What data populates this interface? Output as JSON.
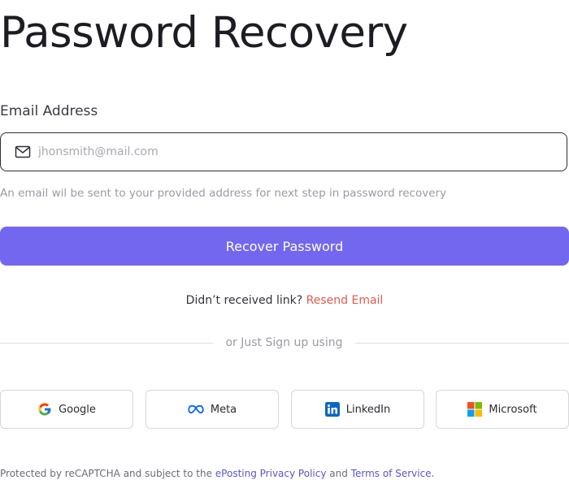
{
  "page": {
    "title": "Password Recovery"
  },
  "form": {
    "email_label": "Email Address",
    "email_placeholder": "jhonsmith@mail.com",
    "email_value": "",
    "hint": "An email wil be sent to your provided address for next step in password recovery",
    "submit_label": "Recover Password"
  },
  "resend": {
    "question": "Didn’t received link?",
    "link_label": "Resend Email"
  },
  "divider": {
    "text": "or Just Sign up using"
  },
  "social": [
    {
      "label": "Google",
      "icon": "google-icon"
    },
    {
      "label": "Meta",
      "icon": "meta-icon"
    },
    {
      "label": "LinkedIn",
      "icon": "linkedin-icon"
    },
    {
      "label": "Microsoft",
      "icon": "microsoft-icon"
    }
  ],
  "legal": {
    "prefix": "Protected by reCAPTCHA and subject to the",
    "privacy_link": "ePosting Privacy Policy",
    "conjunction": "and",
    "terms_link": "Terms of Service."
  },
  "colors": {
    "accent": "#7367f0",
    "resend_link": "#e05a4f",
    "legal_link": "#5b54c9"
  }
}
